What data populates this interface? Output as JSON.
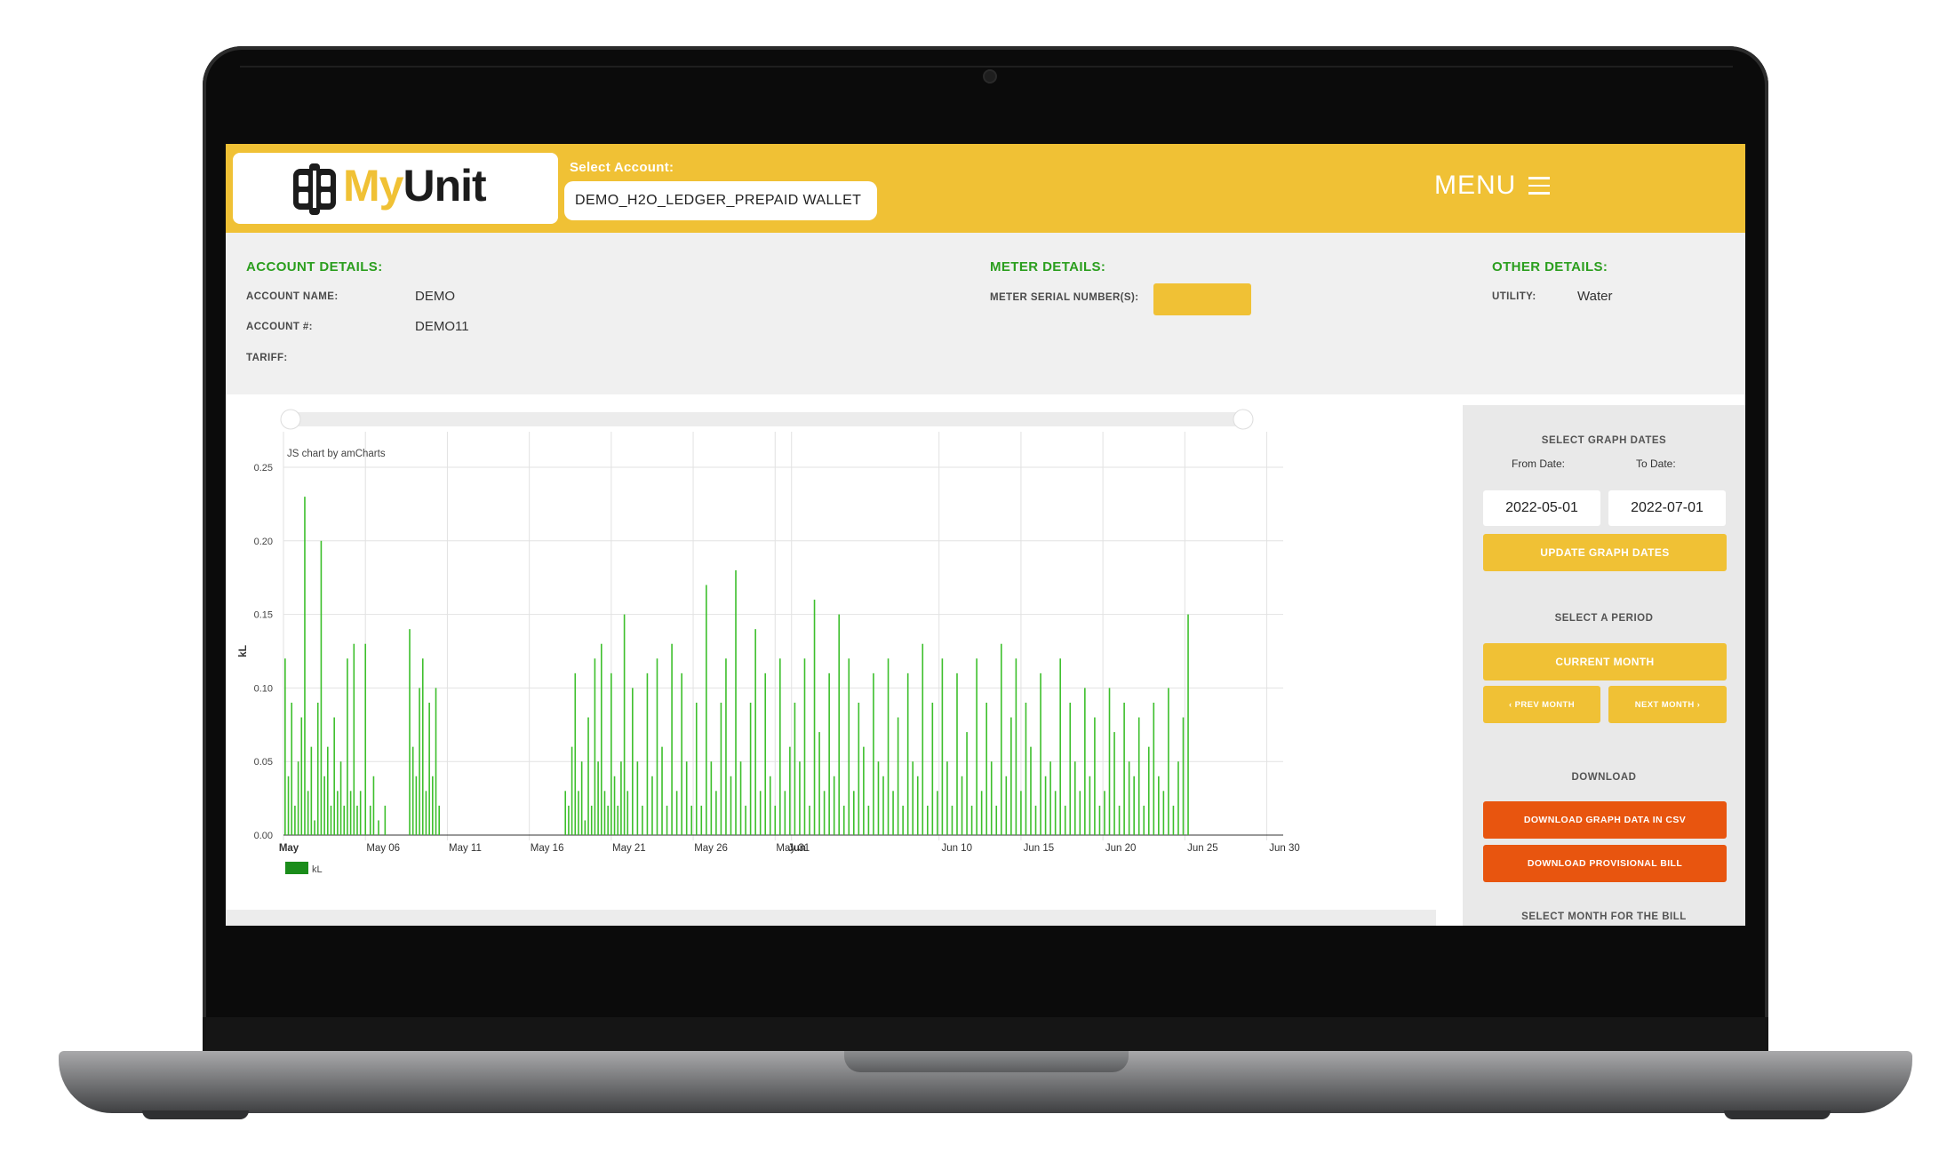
{
  "header": {
    "logo_my": "My",
    "logo_unit": "Unit",
    "select_account_label": "Select Account:",
    "selected_account": "DEMO_H2O_LEDGER_PREPAID WALLET",
    "menu_label": "MENU"
  },
  "account_details": {
    "heading": "ACCOUNT DETAILS:",
    "name_label": "ACCOUNT NAME:",
    "name_value": "DEMO",
    "number_label": "ACCOUNT #:",
    "number_value": "DEMO11",
    "tariff_label": "TARIFF:"
  },
  "meter_details": {
    "heading": "METER DETAILS:",
    "serial_label": "METER SERIAL NUMBER(S):"
  },
  "other_details": {
    "heading": "OTHER DETAILS:",
    "utility_label": "UTILITY:",
    "utility_value": "Water"
  },
  "sidebar": {
    "select_dates_heading": "SELECT GRAPH DATES",
    "from_label": "From Date:",
    "to_label": "To Date:",
    "from_value": "2022-05-01",
    "to_value": "2022-07-01",
    "update_button": "UPDATE GRAPH DATES",
    "select_period_heading": "SELECT A PERIOD",
    "current_month_button": "CURRENT MONTH",
    "prev_month_button": "‹ PREV MONTH",
    "next_month_button": "NEXT MONTH ›",
    "download_heading": "DOWNLOAD",
    "download_csv_button": "DOWNLOAD GRAPH DATA IN CSV",
    "download_bill_button": "DOWNLOAD PROVISIONAL BILL",
    "select_month_heading": "SELECT MONTH FOR THE BILL"
  },
  "colors": {
    "brand_yellow": "#f0c135",
    "accent_green": "#2b9e1e",
    "bar_green": "#3dbf2c",
    "download_orange": "#e8550f"
  },
  "chart_data": {
    "type": "bar",
    "watermark": "JS chart by amCharts",
    "ylabel": "kL",
    "ylim": [
      0,
      0.25
    ],
    "yticks": [
      "0.00",
      "0.05",
      "0.10",
      "0.15",
      "0.20",
      "0.25"
    ],
    "xticks": [
      {
        "label": "May",
        "bold": true,
        "day": 0
      },
      {
        "label": "May 06",
        "bold": false,
        "day": 5
      },
      {
        "label": "May 11",
        "bold": false,
        "day": 10
      },
      {
        "label": "May 16",
        "bold": false,
        "day": 15
      },
      {
        "label": "May 21",
        "bold": false,
        "day": 20
      },
      {
        "label": "May 26",
        "bold": false,
        "day": 25
      },
      {
        "label": "May 31",
        "bold": false,
        "day": 30
      },
      {
        "label": "Jun",
        "bold": true,
        "day": 31
      },
      {
        "label": "Jun 10",
        "bold": false,
        "day": 40
      },
      {
        "label": "Jun 15",
        "bold": false,
        "day": 45
      },
      {
        "label": "Jun 20",
        "bold": false,
        "day": 50
      },
      {
        "label": "Jun 25",
        "bold": false,
        "day": 55
      },
      {
        "label": "Jun 30",
        "bold": false,
        "day": 60
      }
    ],
    "xrange_days": [
      0,
      61
    ],
    "legend": [
      {
        "name": "kL",
        "color": "#1a8c1a"
      }
    ],
    "series": [
      {
        "name": "kL",
        "x_days": [
          0.1,
          0.3,
          0.5,
          0.7,
          0.9,
          1.1,
          1.3,
          1.5,
          1.7,
          1.9,
          2.1,
          2.3,
          2.5,
          2.7,
          2.9,
          3.1,
          3.3,
          3.5,
          3.7,
          3.9,
          4.1,
          4.3,
          4.5,
          4.7,
          5.0,
          5.3,
          5.5,
          5.8,
          6.2,
          7.7,
          7.9,
          8.1,
          8.3,
          8.5,
          8.7,
          8.9,
          9.1,
          9.3,
          9.5,
          17.2,
          17.4,
          17.6,
          17.8,
          18.0,
          18.2,
          18.4,
          18.6,
          18.8,
          19.0,
          19.2,
          19.4,
          19.6,
          19.8,
          20.0,
          20.2,
          20.4,
          20.6,
          20.8,
          21.0,
          21.3,
          21.6,
          21.9,
          22.2,
          22.5,
          22.8,
          23.1,
          23.4,
          23.7,
          24.0,
          24.3,
          24.6,
          24.9,
          25.2,
          25.5,
          25.8,
          26.1,
          26.4,
          26.7,
          27.0,
          27.3,
          27.6,
          27.9,
          28.2,
          28.5,
          28.8,
          29.1,
          29.4,
          29.7,
          30.0,
          30.3,
          30.6,
          30.9,
          31.2,
          31.5,
          31.8,
          32.1,
          32.4,
          32.7,
          33.0,
          33.3,
          33.6,
          33.9,
          34.2,
          34.5,
          34.8,
          35.1,
          35.4,
          35.7,
          36.0,
          36.3,
          36.6,
          36.9,
          37.2,
          37.5,
          37.8,
          38.1,
          38.4,
          38.7,
          39.0,
          39.3,
          39.6,
          39.9,
          40.2,
          40.5,
          40.8,
          41.1,
          41.4,
          41.7,
          42.0,
          42.3,
          42.6,
          42.9,
          43.2,
          43.5,
          43.8,
          44.1,
          44.4,
          44.7,
          45.0,
          45.3,
          45.6,
          45.9,
          46.2,
          46.5,
          46.8,
          47.1,
          47.4,
          47.7,
          48.0,
          48.3,
          48.6,
          48.9,
          49.2,
          49.5,
          49.8,
          50.1,
          50.4,
          50.7,
          51.0,
          51.3,
          51.6,
          51.9,
          52.2,
          52.5,
          52.8,
          53.1,
          53.4,
          53.7,
          54.0,
          54.3,
          54.6,
          54.9,
          55.2
        ],
        "values": [
          0.12,
          0.04,
          0.09,
          0.02,
          0.05,
          0.08,
          0.23,
          0.03,
          0.06,
          0.01,
          0.09,
          0.2,
          0.04,
          0.06,
          0.02,
          0.08,
          0.03,
          0.05,
          0.02,
          0.12,
          0.03,
          0.13,
          0.02,
          0.03,
          0.13,
          0.02,
          0.04,
          0.01,
          0.02,
          0.14,
          0.06,
          0.04,
          0.1,
          0.12,
          0.03,
          0.09,
          0.04,
          0.1,
          0.02,
          0.03,
          0.02,
          0.06,
          0.11,
          0.03,
          0.05,
          0.01,
          0.08,
          0.02,
          0.12,
          0.05,
          0.13,
          0.03,
          0.02,
          0.11,
          0.04,
          0.02,
          0.05,
          0.15,
          0.03,
          0.1,
          0.05,
          0.02,
          0.11,
          0.04,
          0.12,
          0.06,
          0.02,
          0.13,
          0.03,
          0.11,
          0.05,
          0.02,
          0.09,
          0.02,
          0.17,
          0.05,
          0.03,
          0.09,
          0.12,
          0.04,
          0.18,
          0.05,
          0.02,
          0.09,
          0.14,
          0.03,
          0.11,
          0.04,
          0.02,
          0.12,
          0.03,
          0.06,
          0.09,
          0.05,
          0.12,
          0.02,
          0.16,
          0.07,
          0.03,
          0.11,
          0.04,
          0.15,
          0.02,
          0.12,
          0.03,
          0.09,
          0.06,
          0.02,
          0.11,
          0.05,
          0.04,
          0.12,
          0.03,
          0.08,
          0.02,
          0.11,
          0.05,
          0.04,
          0.13,
          0.02,
          0.09,
          0.03,
          0.12,
          0.05,
          0.02,
          0.11,
          0.04,
          0.07,
          0.02,
          0.12,
          0.03,
          0.09,
          0.05,
          0.02,
          0.13,
          0.04,
          0.08,
          0.12,
          0.03,
          0.09,
          0.06,
          0.02,
          0.11,
          0.04,
          0.05,
          0.03,
          0.12,
          0.02,
          0.09,
          0.05,
          0.03,
          0.1,
          0.04,
          0.08,
          0.02,
          0.03,
          0.1,
          0.07,
          0.02,
          0.09,
          0.05,
          0.04,
          0.08,
          0.02,
          0.06,
          0.09,
          0.04,
          0.03,
          0.1,
          0.02,
          0.05,
          0.08,
          0.15,
          0.03,
          0.08
        ]
      }
    ]
  }
}
